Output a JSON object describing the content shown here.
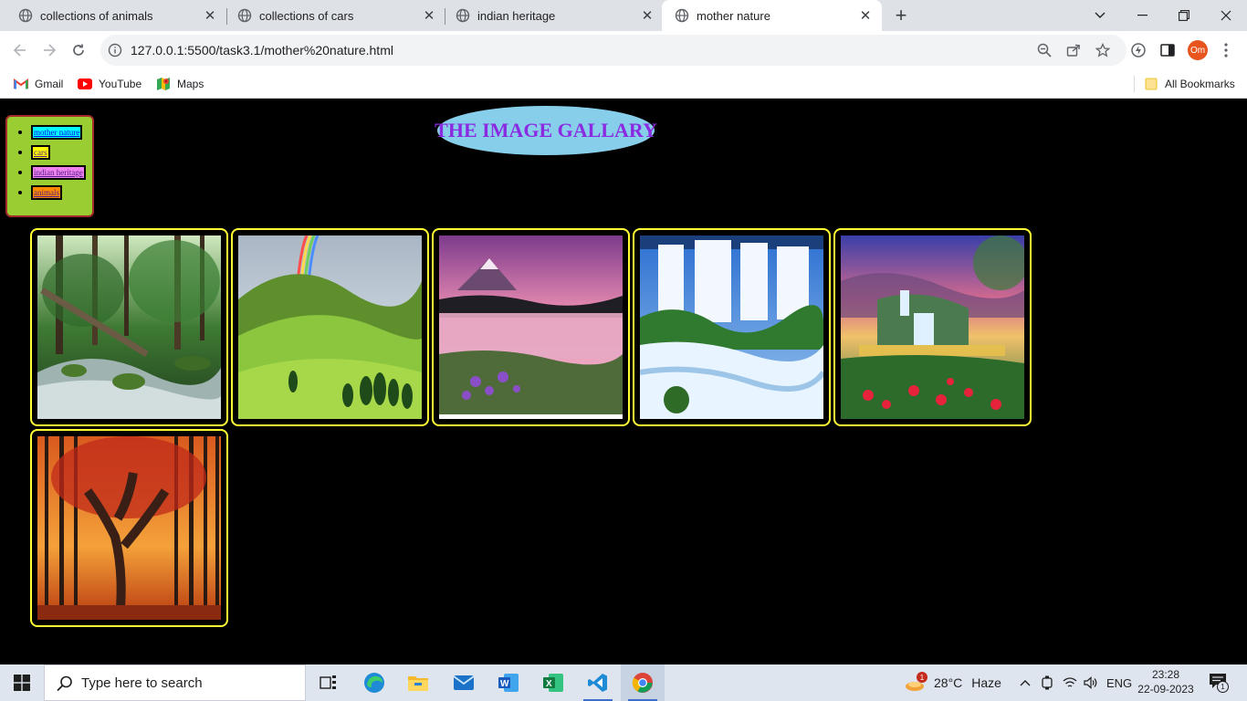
{
  "browser": {
    "tabs": [
      {
        "title": "collections of animals",
        "active": false
      },
      {
        "title": "collections of cars",
        "active": false
      },
      {
        "title": "indian heritage",
        "active": false
      },
      {
        "title": "mother nature",
        "active": true
      }
    ],
    "url": "127.0.0.1:5500/task3.1/mother%20nature.html",
    "profile_initials": "Om",
    "bookmarks": [
      {
        "label": "Gmail",
        "icon": "gmail-icon"
      },
      {
        "label": "YouTube",
        "icon": "youtube-icon"
      },
      {
        "label": "Maps",
        "icon": "maps-icon"
      }
    ],
    "all_bookmarks_label": "All Bookmarks"
  },
  "page": {
    "title": "THE IMAGE GALLARY",
    "nav_links": [
      {
        "label": "mother nature",
        "bg": "#00ffff",
        "color": "#0000ee"
      },
      {
        "label": "cars",
        "bg": "#ffff00",
        "color": "#551a8b"
      },
      {
        "label": "indian heritage",
        "bg": "#ee82ee",
        "color": "#551a8b"
      },
      {
        "label": "animals",
        "bg": "#ff8c00",
        "color": "#551a8b"
      }
    ],
    "gallery": [
      {
        "name": "forest-stream-image"
      },
      {
        "name": "rainbow-hills-image"
      },
      {
        "name": "mountain-lake-image"
      },
      {
        "name": "waterfall-image"
      },
      {
        "name": "fantasy-waterfall-image"
      },
      {
        "name": "autumn-tree-image"
      }
    ],
    "colors": {
      "background": "#000000",
      "nav_bg": "#9acd32",
      "nav_border": "#a52a2a",
      "title_bg": "#87ceeb",
      "title_color": "#8a2be2",
      "frame_border": "#ffff33"
    }
  },
  "taskbar": {
    "search_placeholder": "Type here to search",
    "weather_temp": "28°C",
    "weather_desc": "Haze",
    "weather_badge": "1",
    "language": "ENG",
    "time": "23:28",
    "date": "22-09-2023",
    "notification_count": "1"
  }
}
